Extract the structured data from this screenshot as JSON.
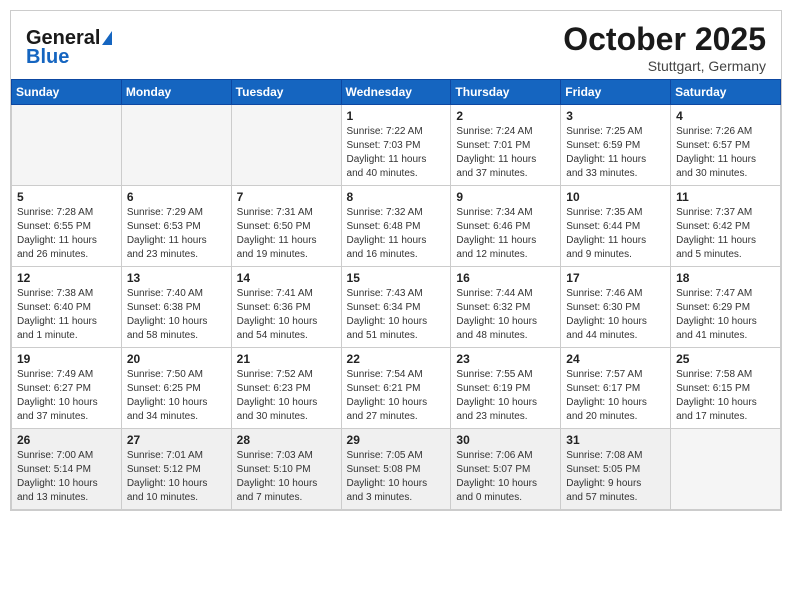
{
  "header": {
    "logo_line1": "General",
    "logo_line2": "Blue",
    "month": "October 2025",
    "location": "Stuttgart, Germany"
  },
  "weekdays": [
    "Sunday",
    "Monday",
    "Tuesday",
    "Wednesday",
    "Thursday",
    "Friday",
    "Saturday"
  ],
  "weeks": [
    [
      {
        "day": "",
        "info": ""
      },
      {
        "day": "",
        "info": ""
      },
      {
        "day": "",
        "info": ""
      },
      {
        "day": "1",
        "info": "Sunrise: 7:22 AM\nSunset: 7:03 PM\nDaylight: 11 hours\nand 40 minutes."
      },
      {
        "day": "2",
        "info": "Sunrise: 7:24 AM\nSunset: 7:01 PM\nDaylight: 11 hours\nand 37 minutes."
      },
      {
        "day": "3",
        "info": "Sunrise: 7:25 AM\nSunset: 6:59 PM\nDaylight: 11 hours\nand 33 minutes."
      },
      {
        "day": "4",
        "info": "Sunrise: 7:26 AM\nSunset: 6:57 PM\nDaylight: 11 hours\nand 30 minutes."
      }
    ],
    [
      {
        "day": "5",
        "info": "Sunrise: 7:28 AM\nSunset: 6:55 PM\nDaylight: 11 hours\nand 26 minutes."
      },
      {
        "day": "6",
        "info": "Sunrise: 7:29 AM\nSunset: 6:53 PM\nDaylight: 11 hours\nand 23 minutes."
      },
      {
        "day": "7",
        "info": "Sunrise: 7:31 AM\nSunset: 6:50 PM\nDaylight: 11 hours\nand 19 minutes."
      },
      {
        "day": "8",
        "info": "Sunrise: 7:32 AM\nSunset: 6:48 PM\nDaylight: 11 hours\nand 16 minutes."
      },
      {
        "day": "9",
        "info": "Sunrise: 7:34 AM\nSunset: 6:46 PM\nDaylight: 11 hours\nand 12 minutes."
      },
      {
        "day": "10",
        "info": "Sunrise: 7:35 AM\nSunset: 6:44 PM\nDaylight: 11 hours\nand 9 minutes."
      },
      {
        "day": "11",
        "info": "Sunrise: 7:37 AM\nSunset: 6:42 PM\nDaylight: 11 hours\nand 5 minutes."
      }
    ],
    [
      {
        "day": "12",
        "info": "Sunrise: 7:38 AM\nSunset: 6:40 PM\nDaylight: 11 hours\nand 1 minute."
      },
      {
        "day": "13",
        "info": "Sunrise: 7:40 AM\nSunset: 6:38 PM\nDaylight: 10 hours\nand 58 minutes."
      },
      {
        "day": "14",
        "info": "Sunrise: 7:41 AM\nSunset: 6:36 PM\nDaylight: 10 hours\nand 54 minutes."
      },
      {
        "day": "15",
        "info": "Sunrise: 7:43 AM\nSunset: 6:34 PM\nDaylight: 10 hours\nand 51 minutes."
      },
      {
        "day": "16",
        "info": "Sunrise: 7:44 AM\nSunset: 6:32 PM\nDaylight: 10 hours\nand 48 minutes."
      },
      {
        "day": "17",
        "info": "Sunrise: 7:46 AM\nSunset: 6:30 PM\nDaylight: 10 hours\nand 44 minutes."
      },
      {
        "day": "18",
        "info": "Sunrise: 7:47 AM\nSunset: 6:29 PM\nDaylight: 10 hours\nand 41 minutes."
      }
    ],
    [
      {
        "day": "19",
        "info": "Sunrise: 7:49 AM\nSunset: 6:27 PM\nDaylight: 10 hours\nand 37 minutes."
      },
      {
        "day": "20",
        "info": "Sunrise: 7:50 AM\nSunset: 6:25 PM\nDaylight: 10 hours\nand 34 minutes."
      },
      {
        "day": "21",
        "info": "Sunrise: 7:52 AM\nSunset: 6:23 PM\nDaylight: 10 hours\nand 30 minutes."
      },
      {
        "day": "22",
        "info": "Sunrise: 7:54 AM\nSunset: 6:21 PM\nDaylight: 10 hours\nand 27 minutes."
      },
      {
        "day": "23",
        "info": "Sunrise: 7:55 AM\nSunset: 6:19 PM\nDaylight: 10 hours\nand 23 minutes."
      },
      {
        "day": "24",
        "info": "Sunrise: 7:57 AM\nSunset: 6:17 PM\nDaylight: 10 hours\nand 20 minutes."
      },
      {
        "day": "25",
        "info": "Sunrise: 7:58 AM\nSunset: 6:15 PM\nDaylight: 10 hours\nand 17 minutes."
      }
    ],
    [
      {
        "day": "26",
        "info": "Sunrise: 7:00 AM\nSunset: 5:14 PM\nDaylight: 10 hours\nand 13 minutes."
      },
      {
        "day": "27",
        "info": "Sunrise: 7:01 AM\nSunset: 5:12 PM\nDaylight: 10 hours\nand 10 minutes."
      },
      {
        "day": "28",
        "info": "Sunrise: 7:03 AM\nSunset: 5:10 PM\nDaylight: 10 hours\nand 7 minutes."
      },
      {
        "day": "29",
        "info": "Sunrise: 7:05 AM\nSunset: 5:08 PM\nDaylight: 10 hours\nand 3 minutes."
      },
      {
        "day": "30",
        "info": "Sunrise: 7:06 AM\nSunset: 5:07 PM\nDaylight: 10 hours\nand 0 minutes."
      },
      {
        "day": "31",
        "info": "Sunrise: 7:08 AM\nSunset: 5:05 PM\nDaylight: 9 hours\nand 57 minutes."
      },
      {
        "day": "",
        "info": ""
      }
    ]
  ]
}
